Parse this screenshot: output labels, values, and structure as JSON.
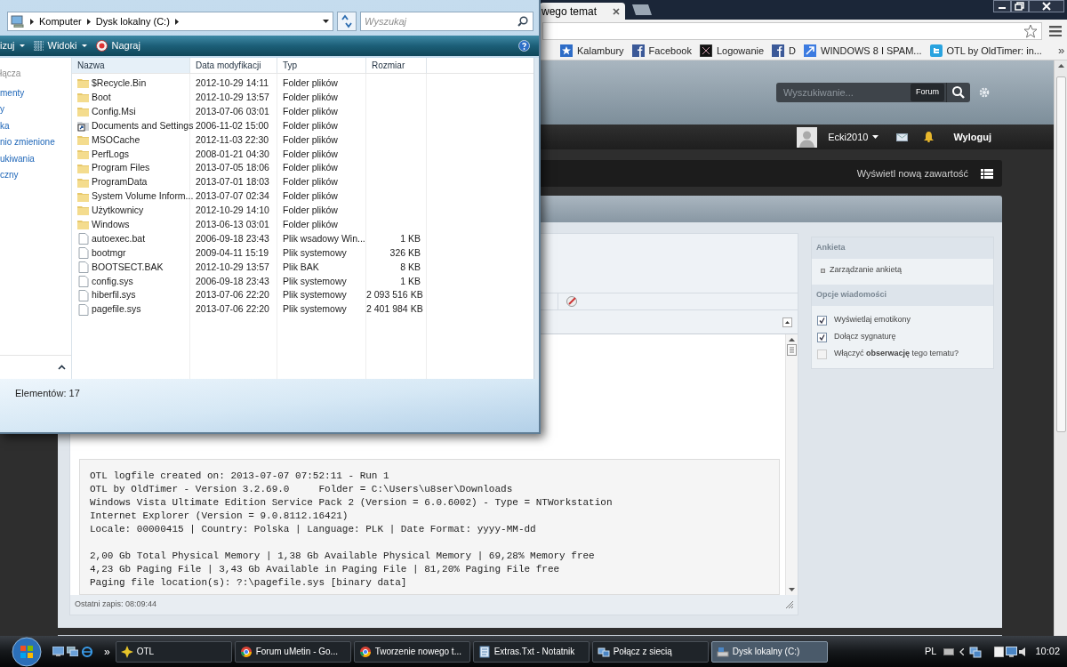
{
  "browser": {
    "tabs": [
      {
        "label": "wego temat",
        "selected": true
      }
    ],
    "bookmarks": [
      {
        "kind": "star",
        "label": "Kalambury"
      },
      {
        "kind": "square",
        "label": "Facebook"
      },
      {
        "kind": "dark",
        "label": "Logowanie"
      },
      {
        "kind": "square",
        "label": "D"
      },
      {
        "kind": "arrow",
        "label": "WINDOWS 8 I SPAM..."
      },
      {
        "kind": "bird",
        "label": "OTL by OldTimer: in..."
      }
    ],
    "bookmarks_more": "»"
  },
  "forum": {
    "search_placeholder": "Wyszukiwanie...",
    "search_scope": "Forum",
    "user": "Ecki2010",
    "logout": "Wyloguj",
    "new_content": "Wyświetl nową zawartość"
  },
  "sidebar": {
    "sections": [
      {
        "title": "Ankieta",
        "items": [
          {
            "kind": "link",
            "label": "Zarządzanie ankietą"
          }
        ]
      },
      {
        "title": "Opcje wiadomości",
        "items": [
          {
            "kind": "checkbox",
            "label": "Wyświetlaj emotikony",
            "checked": true
          },
          {
            "kind": "checkbox",
            "label": "Dołącz sygnaturę",
            "checked": true
          },
          {
            "kind": "checkbox",
            "label": "Włączyć **obserwację** tego tematu?",
            "checked": false
          }
        ]
      }
    ]
  },
  "editor": {
    "log_blocks": [
      [
        "OTL logfile created on: 2013-07-07 07:52:11 - Run 1",
        "OTL by OldTimer - Version 3.2.69.0     Folder = C:\\Users\\u8ser\\Downloads",
        "Windows Vista Ultimate Edition Service Pack 2 (Version = 6.0.6002) - Type = NTWorkstation",
        "Internet Explorer (Version = 9.0.8112.16421)",
        "Locale: 00000415 | Country: Polska | Language: PLK | Date Format: yyyy-MM-dd"
      ],
      [
        "2,00 Gb Total Physical Memory | 1,38 Gb Available Physical Memory | 69,28% Memory free",
        "4,23 Gb Paging File | 3,43 Gb Available in Paging File | 81,20% Paging File free",
        "Paging file location(s): ?:\\pagefile.sys [binary data]"
      ]
    ],
    "last_saved": "Ostatni zapis: 08:09:44"
  },
  "explorer": {
    "breadcrumb": [
      "Komputer",
      "Dysk lokalny (C:)"
    ],
    "search_placeholder": "Wyszukaj",
    "toolbar": [
      {
        "kind": "menu",
        "label": "izuj"
      },
      {
        "kind": "views",
        "label": "Widoki"
      },
      {
        "kind": "burn",
        "label": "Nagraj"
      }
    ],
    "nav": [
      {
        "label": "łącza",
        "kind": "heading"
      },
      {
        "label": "menty",
        "kind": "link"
      },
      {
        "label": "y",
        "kind": "link"
      },
      {
        "label": "ka",
        "kind": "link"
      },
      {
        "label": "nio zmienione",
        "kind": "link"
      },
      {
        "label": "ukiwania",
        "kind": "link"
      },
      {
        "label": "czny",
        "kind": "link"
      }
    ],
    "columns": [
      "Nazwa",
      "Data modyfikacji",
      "Typ",
      "Rozmiar"
    ],
    "rows": [
      {
        "kind": "folder",
        "name": "$Recycle.Bin",
        "date": "2012-10-29 14:11",
        "type": "Folder plików"
      },
      {
        "kind": "folder",
        "name": "Boot",
        "date": "2012-10-29 13:57",
        "type": "Folder plików"
      },
      {
        "kind": "folder",
        "name": "Config.Msi",
        "date": "2013-07-06 03:01",
        "type": "Folder plików"
      },
      {
        "kind": "shortcut",
        "name": "Documents and Settings",
        "date": "2006-11-02 15:00",
        "type": "Folder plików"
      },
      {
        "kind": "folder",
        "name": "MSOCache",
        "date": "2012-11-03 22:30",
        "type": "Folder plików"
      },
      {
        "kind": "folder",
        "name": "PerfLogs",
        "date": "2008-01-21 04:30",
        "type": "Folder plików"
      },
      {
        "kind": "folder",
        "name": "Program Files",
        "date": "2013-07-05 18:06",
        "type": "Folder plików"
      },
      {
        "kind": "folder",
        "name": "ProgramData",
        "date": "2013-07-01 18:03",
        "type": "Folder plików"
      },
      {
        "kind": "folder",
        "name": "System Volume Inform...",
        "date": "2013-07-07 02:34",
        "type": "Folder plików"
      },
      {
        "kind": "folder",
        "name": "Użytkownicy",
        "date": "2012-10-29 14:10",
        "type": "Folder plików"
      },
      {
        "kind": "folder",
        "name": "Windows",
        "date": "2013-06-13 03:01",
        "type": "Folder plików"
      },
      {
        "kind": "file",
        "name": "autoexec.bat",
        "date": "2006-09-18 23:43",
        "type": "Plik wsadowy Win...",
        "size": "1 KB"
      },
      {
        "kind": "file",
        "name": "bootmgr",
        "date": "2009-04-11 15:19",
        "type": "Plik systemowy",
        "size": "326 KB"
      },
      {
        "kind": "file",
        "name": "BOOTSECT.BAK",
        "date": "2012-10-29 13:57",
        "type": "Plik BAK",
        "size": "8 KB"
      },
      {
        "kind": "file",
        "name": "config.sys",
        "date": "2006-09-18 23:43",
        "type": "Plik systemowy",
        "size": "1 KB"
      },
      {
        "kind": "file",
        "name": "hiberfil.sys",
        "date": "2013-07-06 22:20",
        "type": "Plik systemowy",
        "size": "2 093 516 KB"
      },
      {
        "kind": "file",
        "name": "pagefile.sys",
        "date": "2013-07-06 22:20",
        "type": "Plik systemowy",
        "size": "2 401 984 KB"
      }
    ],
    "status": "Elementów: 17"
  },
  "taskbar": {
    "quick_launch_more": "»",
    "items": [
      {
        "kind": "otl",
        "label": "OTL",
        "selected": false
      },
      {
        "kind": "browser",
        "label": "Forum uMetin - Go...",
        "selected": false
      },
      {
        "kind": "browser",
        "label": "Tworzenie nowego t...",
        "selected": false
      },
      {
        "kind": "notepad",
        "label": "Extras.Txt - Notatnik",
        "selected": false
      },
      {
        "kind": "network",
        "label": "Połącz z siecią",
        "selected": false
      },
      {
        "kind": "drive",
        "label": "Dysk lokalny (C:)",
        "selected": true
      }
    ],
    "language": "PL",
    "time": "10:02"
  }
}
